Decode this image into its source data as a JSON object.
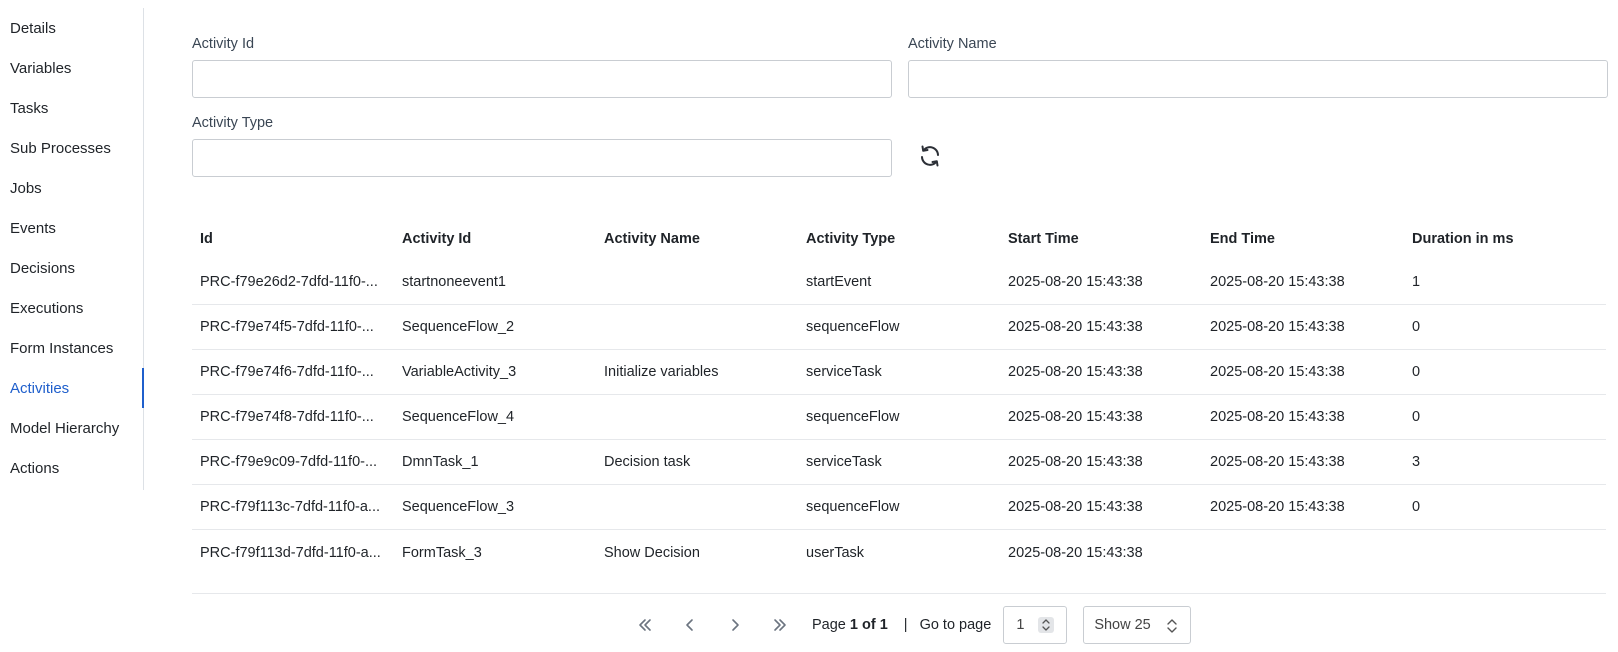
{
  "sidebar": {
    "items": [
      {
        "label": "Details",
        "active": false
      },
      {
        "label": "Variables",
        "active": false
      },
      {
        "label": "Tasks",
        "active": false
      },
      {
        "label": "Sub Processes",
        "active": false
      },
      {
        "label": "Jobs",
        "active": false
      },
      {
        "label": "Events",
        "active": false
      },
      {
        "label": "Decisions",
        "active": false
      },
      {
        "label": "Executions",
        "active": false
      },
      {
        "label": "Form Instances",
        "active": false
      },
      {
        "label": "Activities",
        "active": true
      },
      {
        "label": "Model Hierarchy",
        "active": false
      },
      {
        "label": "Actions",
        "active": false
      }
    ],
    "accent_color": "#1f5fcc"
  },
  "filters": {
    "activity_id": {
      "label": "Activity Id",
      "value": ""
    },
    "activity_name": {
      "label": "Activity Name",
      "value": ""
    },
    "activity_type": {
      "label": "Activity Type",
      "value": ""
    },
    "refresh_icon": "refresh-icon"
  },
  "table": {
    "columns": [
      "Id",
      "Activity Id",
      "Activity Name",
      "Activity Type",
      "Start Time",
      "End Time",
      "Duration in ms"
    ],
    "rows": [
      [
        "PRC-f79e26d2-7dfd-11f0-...",
        "startnoneevent1",
        "",
        "startEvent",
        "2025-08-20 15:43:38",
        "2025-08-20 15:43:38",
        "1"
      ],
      [
        "PRC-f79e74f5-7dfd-11f0-...",
        "SequenceFlow_2",
        "",
        "sequenceFlow",
        "2025-08-20 15:43:38",
        "2025-08-20 15:43:38",
        "0"
      ],
      [
        "PRC-f79e74f6-7dfd-11f0-...",
        "VariableActivity_3",
        "Initialize variables",
        "serviceTask",
        "2025-08-20 15:43:38",
        "2025-08-20 15:43:38",
        "0"
      ],
      [
        "PRC-f79e74f8-7dfd-11f0-...",
        "SequenceFlow_4",
        "",
        "sequenceFlow",
        "2025-08-20 15:43:38",
        "2025-08-20 15:43:38",
        "0"
      ],
      [
        "PRC-f79e9c09-7dfd-11f0-...",
        "DmnTask_1",
        "Decision task",
        "serviceTask",
        "2025-08-20 15:43:38",
        "2025-08-20 15:43:38",
        "3"
      ],
      [
        "PRC-f79f113c-7dfd-11f0-a...",
        "SequenceFlow_3",
        "",
        "sequenceFlow",
        "2025-08-20 15:43:38",
        "2025-08-20 15:43:38",
        "0"
      ],
      [
        "PRC-f79f113d-7dfd-11f0-a...",
        "FormTask_3",
        "Show Decision",
        "userTask",
        "2025-08-20 15:43:38",
        "",
        ""
      ]
    ]
  },
  "pagination": {
    "page_prefix": "Page",
    "page_current": "1 of 1",
    "separator": "|",
    "goto_label": "Go to page",
    "goto_value": "1",
    "show_label": "Show 25"
  }
}
